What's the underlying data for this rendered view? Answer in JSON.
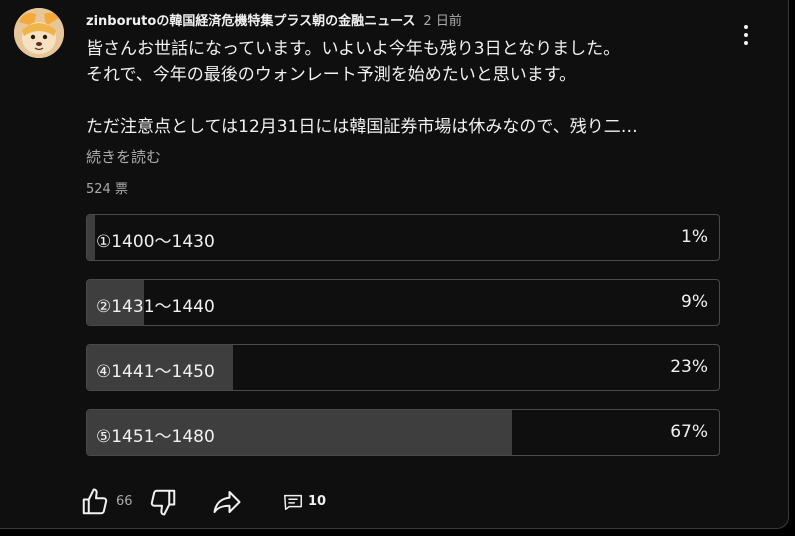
{
  "post": {
    "author": "zinborutoの韓国経済危機特集プラス朝の金融ニュース",
    "date": "2 日前",
    "lines": [
      "皆さんお世話になっています。いよいよ今年も残り3日となりました。",
      "それで、今年の最後のウォンレート予測を始めたいと思います。",
      "",
      "ただ注意点としては12月31日には韓国証券市場は休みなので、残り二…"
    ],
    "read_more": "続きを読む",
    "votes": "524 票"
  },
  "poll": {
    "options": [
      {
        "label": "①1400〜1430",
        "percent": "1%",
        "fraction": 0.01
      },
      {
        "label": "②1431〜1440",
        "percent": "9%",
        "fraction": 0.09
      },
      {
        "label": "④1441〜1450",
        "percent": "23%",
        "fraction": 0.23
      },
      {
        "label": "⑤1451〜1480",
        "percent": "67%",
        "fraction": 0.67
      }
    ]
  },
  "actions": {
    "like_count": "66",
    "comment_count": "10",
    "icons": [
      "thumbs-up-icon",
      "thumbs-down-icon",
      "share-icon",
      "comment-icon"
    ]
  },
  "colors": {
    "background": "#0f0f0f",
    "bar_fill": "#3e3e3e",
    "text": "#f1f1f1",
    "muted": "#aaaaaa"
  }
}
